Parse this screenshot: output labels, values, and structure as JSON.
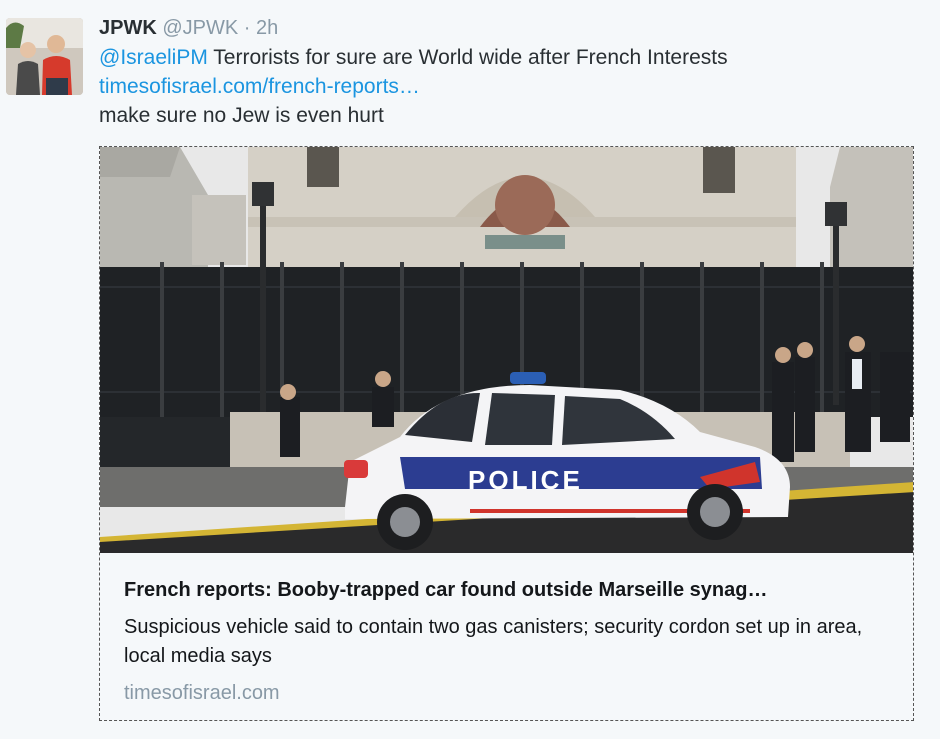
{
  "tweet": {
    "author_name": "JPWK",
    "author_handle": "@JPWK",
    "separator": "·",
    "timestamp": "2h",
    "mention": "@IsraeliPM",
    "text_line1_rest": " Terrorists for sure are World wide after French Interests",
    "link_text": "timesofisrael.com/french-reports…",
    "text_line3": "make sure no Jew is even hurt"
  },
  "card": {
    "title": "French reports: Booby-trapped car found outside Marseille synag…",
    "description": "Suspicious vehicle said to contain two gas canisters; security cordon set up in area, local media says",
    "domain": "timesofisrael.com",
    "police_label": "POLICE"
  },
  "colors": {
    "link": "#1b95e0",
    "muted": "#8899a6",
    "background": "#f5f8fa"
  }
}
